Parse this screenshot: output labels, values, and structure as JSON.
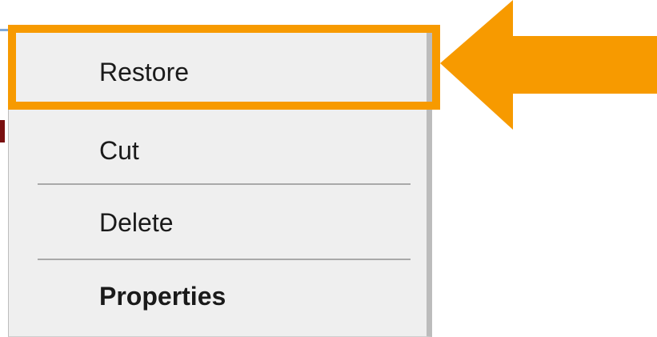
{
  "context_menu": {
    "items": [
      {
        "label": "Restore"
      },
      {
        "label": "Cut"
      },
      {
        "label": "Delete"
      },
      {
        "label": "Properties"
      }
    ]
  },
  "annotation": {
    "highlight_color": "#f79a00",
    "arrow_color": "#f79a00",
    "arrow_icon": "arrow-left-icon"
  }
}
